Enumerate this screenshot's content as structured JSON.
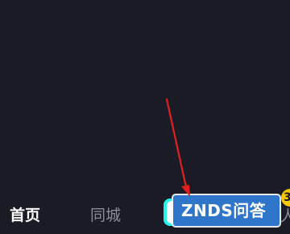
{
  "bottom_nav": {
    "home_label": "首页",
    "city_label": "同城",
    "me_partial": "人",
    "badge_count": "3"
  },
  "watermark": {
    "text": "ZNDS问答"
  },
  "colors": {
    "background": "#1b1b25",
    "active_tab": "#ffffff",
    "inactive_tab": "#8c8c96",
    "arrow": "#e02020",
    "watermark_bg": "#2f75c9",
    "badge_bg": "#f7c900",
    "add_button_accent": "#25f4ee"
  }
}
